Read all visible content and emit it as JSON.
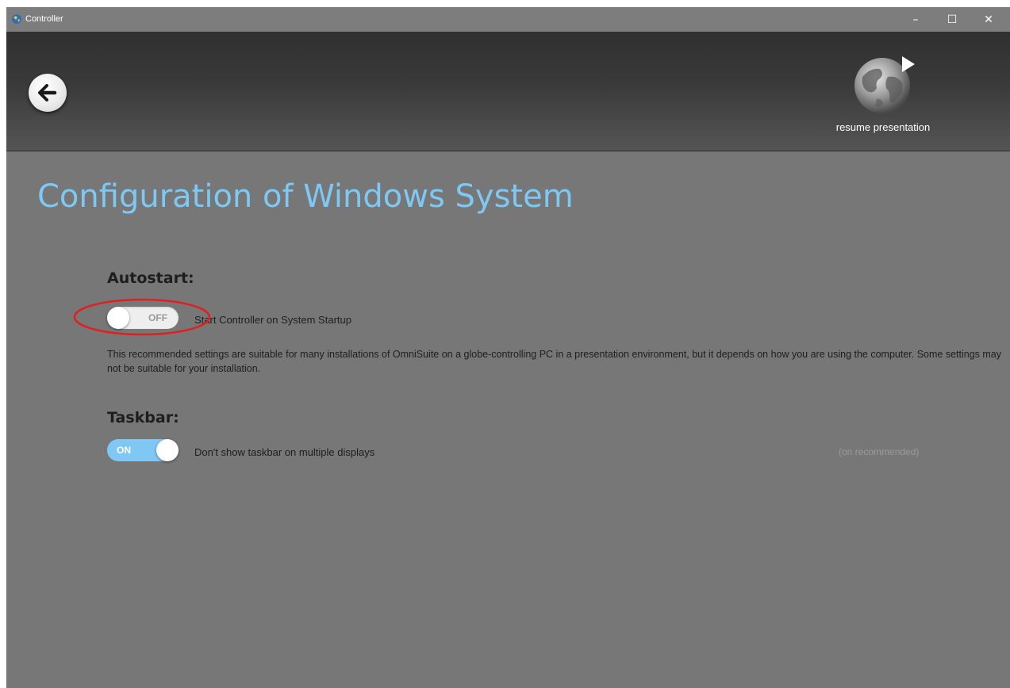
{
  "titlebar": {
    "title": "Controller",
    "app_icon": "controller-globe-icon",
    "minimize": "–",
    "maximize": "☐",
    "close": "✕"
  },
  "header": {
    "back_icon": "back-arrow-icon",
    "resume_icon": "globe-play-icon",
    "resume_label": "resume presentation"
  },
  "page": {
    "title": "Configuration of Windows System"
  },
  "autostart": {
    "heading": "Autostart:",
    "toggle_state": "OFF",
    "toggle_on": false,
    "label": "Start Controller on System Startup",
    "description": "This recommended settings are suitable for many installations of OmniSuite on a globe-controlling PC in a presentation environment, but it depends on how you are using the computer. Some settings may not be suitable for your installation."
  },
  "taskbar": {
    "heading": "Taskbar:",
    "toggle_state": "ON",
    "toggle_on": true,
    "label": "Don't show taskbar on multiple displays",
    "hint": "(on recommended)"
  },
  "colors": {
    "accent": "#7ec8f4",
    "background": "#777777",
    "highlight": "#e02020"
  }
}
